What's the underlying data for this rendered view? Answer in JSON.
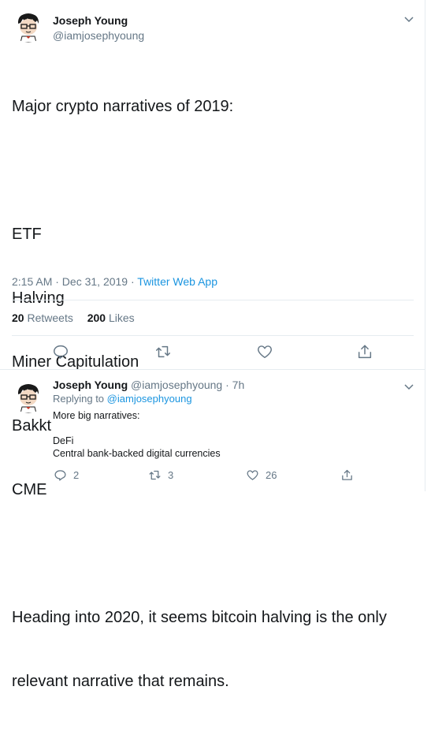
{
  "main_tweet": {
    "author_name": "Joseph Young",
    "author_handle": "@iamjosephyoung",
    "lines": [
      "Major crypto narratives of 2019:",
      "",
      "ETF",
      "Halving",
      "Miner Capitulation",
      "Bakkt",
      "CME",
      "",
      "Heading into 2020, it seems bitcoin halving is the only",
      "relevant narrative that remains."
    ],
    "timestamp": "2:15 AM · Dec 31, 2019",
    "separator": " · ",
    "source": "Twitter Web App",
    "retweets_count": "20",
    "retweets_label": "Retweets",
    "likes_count": "200",
    "likes_label": "Likes"
  },
  "reply_tweet": {
    "author_name": "Joseph Young",
    "author_handle": "@iamjosephyoung",
    "time": "· 7h",
    "replying_prefix": "Replying to",
    "replying_handle": "@iamjosephyoung",
    "body": "More big narratives:\n\nDeFi\nCentral bank-backed digital currencies",
    "reply_count": "2",
    "retweet_count": "3",
    "like_count": "26"
  },
  "icons": {
    "more": "chevron-down-icon",
    "reply": "reply-icon",
    "retweet": "retweet-icon",
    "like": "heart-icon",
    "share": "share-icon"
  },
  "colors": {
    "text": "#14171a",
    "secondary": "#657786",
    "link": "#1b95e0",
    "divider": "#e6ecf0"
  }
}
